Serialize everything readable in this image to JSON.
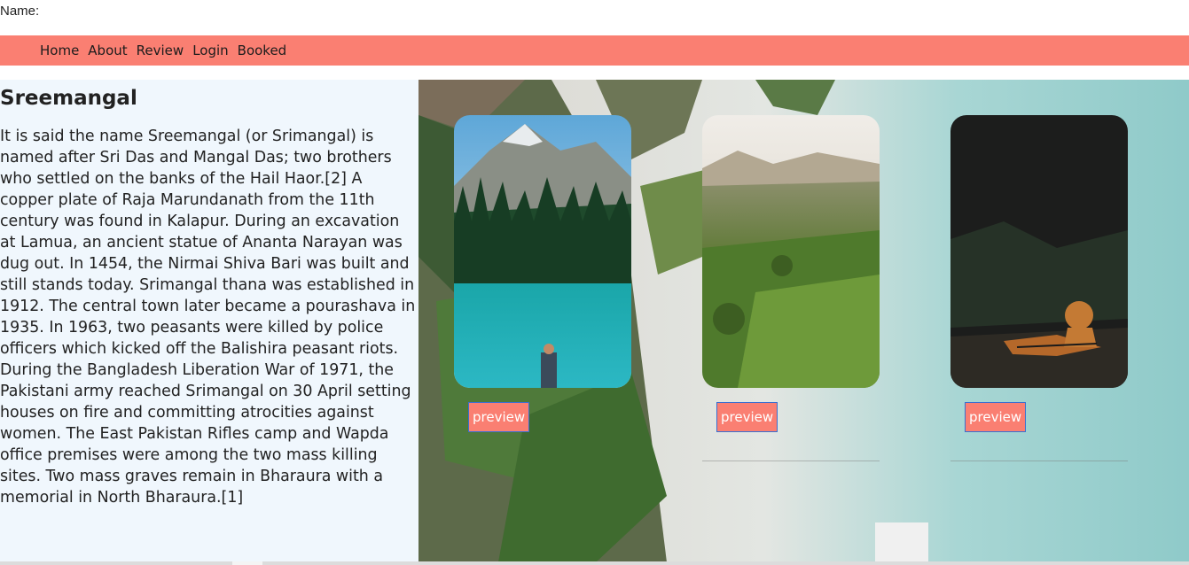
{
  "header": {
    "name_label": "Name:"
  },
  "nav": {
    "items": [
      "Home",
      "About",
      "Review",
      "Login",
      "Booked"
    ]
  },
  "article": {
    "title": "Sreemangal",
    "body": "It is said the name Sreemangal (or Srimangal) is named after Sri Das and Mangal Das; two brothers who settled on the banks of the Hail Haor.[2] A copper plate of Raja Marundanath from the 11th century was found in Kalapur. During an excavation at Lamua, an ancient statue of Ananta Narayan was dug out. In 1454, the Nirmai Shiva Bari was built and still stands today. Srimangal thana was established in 1912. The central town later became a pourashava in 1935. In 1963, two peasants were killed by police officers which kicked off the Balishira peasant riots. During the Bangladesh Liberation War of 1971, the Pakistani army reached Srimangal on 30 April setting houses on fire and committing atrocities against women. The East Pakistan Rifles camp and Wapda office premises were among the two mass killing sites. Two mass graves remain in Bharaura with a memorial in North Bharaura.[1]"
  },
  "cards": [
    {
      "image": "mountain-lake-hiker",
      "button": "preview"
    },
    {
      "image": "tea-garden-hills",
      "button": "preview"
    },
    {
      "image": "tiger-resting",
      "button": "preview"
    }
  ],
  "colors": {
    "nav_bg": "#fa7f72",
    "article_bg": "#f0f7fd",
    "button_bg": "#fa7f72"
  }
}
